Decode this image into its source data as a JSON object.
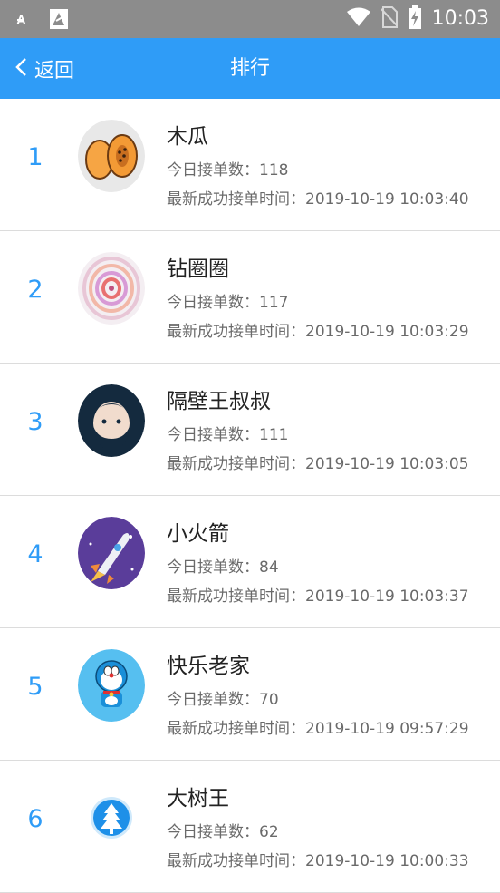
{
  "status_bar": {
    "time": "10:03",
    "icons": [
      "font-icon",
      "app-notification-icon",
      "wifi-icon",
      "no-sim-icon",
      "battery-charging-icon"
    ]
  },
  "nav": {
    "back_label": "返回",
    "title": "排行"
  },
  "ranking": [
    {
      "rank": "1",
      "name": "木瓜",
      "orders_label": "今日接单数：118",
      "time_label": "最新成功接单时间：2019-10-19 10:03:40",
      "avatar": "papaya-avatar"
    },
    {
      "rank": "2",
      "name": "钻圈圈",
      "orders_label": "今日接单数：117",
      "time_label": "最新成功接单时间：2019-10-19 10:03:29",
      "avatar": "spiral-avatar"
    },
    {
      "rank": "3",
      "name": "隔壁王叔叔",
      "orders_label": "今日接单数：111",
      "time_label": "最新成功接单时间：2019-10-19 10:03:05",
      "avatar": "bearded-man-avatar"
    },
    {
      "rank": "4",
      "name": "小火箭",
      "orders_label": "今日接单数：84",
      "time_label": "最新成功接单时间：2019-10-19 10:03:37",
      "avatar": "rocket-avatar"
    },
    {
      "rank": "5",
      "name": "快乐老家",
      "orders_label": "今日接单数：70",
      "time_label": "最新成功接单时间：2019-10-19 09:57:29",
      "avatar": "doraemon-avatar"
    },
    {
      "rank": "6",
      "name": "大树王",
      "orders_label": "今日接单数：62",
      "time_label": "最新成功接单时间：2019-10-19 10:00:33",
      "avatar": "tree-avatar"
    }
  ],
  "colors": {
    "accent": "#2f9cf7",
    "status_bar": "#8c8c8c",
    "divider": "#dcdcdc"
  }
}
